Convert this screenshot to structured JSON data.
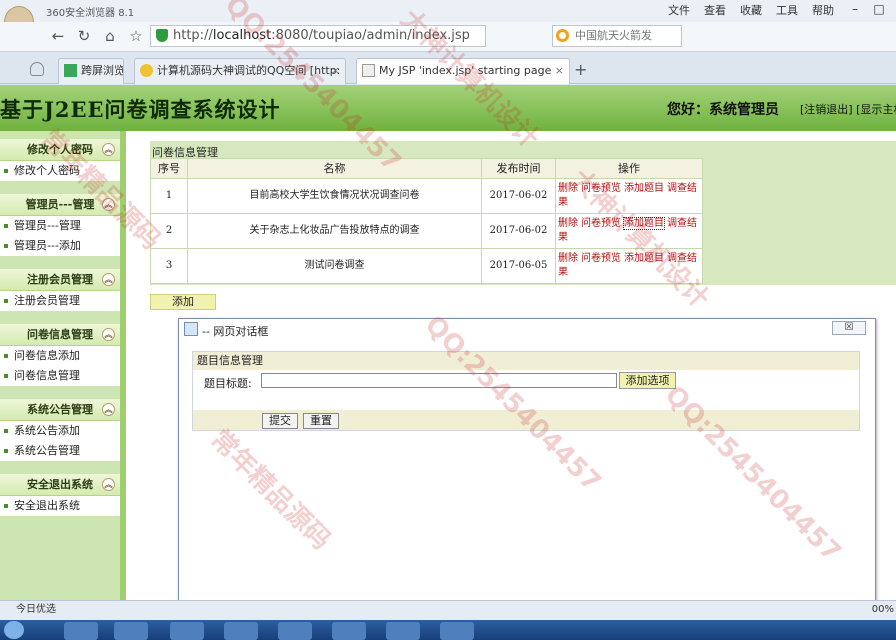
{
  "browser": {
    "name": "360安全浏览器 8.1",
    "menu": [
      "文件",
      "查看",
      "收藏",
      "工具",
      "帮助"
    ],
    "url_prefix": "http://",
    "url_host": "localhost",
    "url_rest": ":8080/toupiao/admin/index.jsp",
    "search": "中国航天火箭发",
    "tabs": [
      "跨屏浏览",
      "计算机源码大神调试的QQ空间 [http:",
      "My JSP 'index.jsp' starting page"
    ]
  },
  "header": {
    "title": "基于J2EE问卷调查系统设计",
    "greeting": "您好：系统管理员",
    "links": "[注销退出] [显示主机"
  },
  "sidebar": [
    {
      "title": "修改个人密码",
      "items": [
        "修改个人密码"
      ]
    },
    {
      "title": "管理员---管理",
      "items": [
        "管理员---管理",
        "管理员---添加"
      ]
    },
    {
      "title": "注册会员管理",
      "items": [
        "注册会员管理"
      ]
    },
    {
      "title": "问卷信息管理",
      "items": [
        "问卷信息添加",
        "问卷信息管理"
      ]
    },
    {
      "title": "系统公告管理",
      "items": [
        "系统公告添加",
        "系统公告管理"
      ]
    },
    {
      "title": "安全退出系统",
      "items": [
        "安全退出系统"
      ]
    }
  ],
  "main": {
    "title": "问卷信息管理",
    "columns": [
      "序号",
      "名称",
      "发布时间",
      "操作"
    ],
    "rows": [
      {
        "no": "1",
        "name": "目前高校大学生饮食情况状况调查问卷",
        "date": "2017-06-02"
      },
      {
        "no": "2",
        "name": "关于杂志上化妆品广告投放特点的调查",
        "date": "2017-06-02"
      },
      {
        "no": "3",
        "name": "测试问卷调查",
        "date": "2017-06-05"
      }
    ],
    "ops": [
      "删除",
      "问卷预览",
      "添加题目",
      "调查结果"
    ],
    "add_label": "添加"
  },
  "dialog": {
    "title": "-- 网页对话框",
    "close": "☒",
    "form_title": "题目信息管理",
    "field_label": "题目标题:",
    "field_value": "",
    "add_option": "添加选项",
    "submit": "提交",
    "reset": "重置"
  },
  "status": {
    "text": "今日优选",
    "zoom": "00%"
  },
  "watermarks": [
    "QQ:2545404457",
    "大神计算机设计",
    "常年精品源码"
  ],
  "colors": {
    "header_green": "#6fb23e",
    "sidebar_green": "#cde5b2",
    "op_red": "#b01010"
  }
}
